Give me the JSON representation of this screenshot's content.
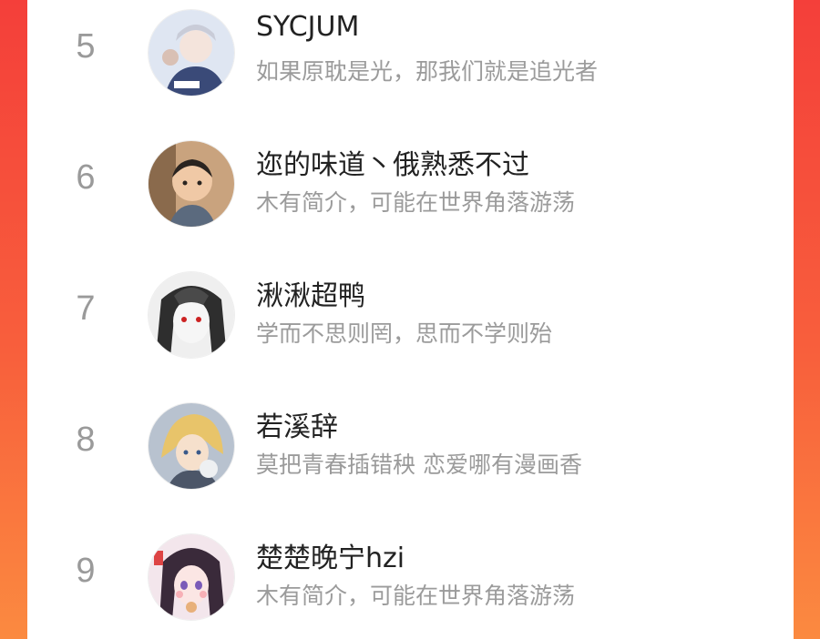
{
  "ranking": {
    "rows": [
      {
        "rank": "5",
        "name": "SYCJUM",
        "bio": "如果原耽是光，那我们就是追光者",
        "avatar": "avatar-anime-boy"
      },
      {
        "rank": "6",
        "name": "迩的味道丶俄熟悉不过",
        "bio": "木有简介，可能在世界角落游荡",
        "avatar": "avatar-child-photo"
      },
      {
        "rank": "7",
        "name": "湫湫超鸭",
        "bio": "学而不思则罔，思而不学则殆",
        "avatar": "avatar-anime-grayscale"
      },
      {
        "rank": "8",
        "name": "若溪辞",
        "bio": "莫把青春插错秧 恋爱哪有漫画香",
        "avatar": "avatar-anime-blond"
      },
      {
        "rank": "9",
        "name": "楚楚晚宁hzi",
        "bio": "木有简介，可能在世界角落游荡",
        "avatar": "avatar-anime-girl"
      }
    ]
  }
}
